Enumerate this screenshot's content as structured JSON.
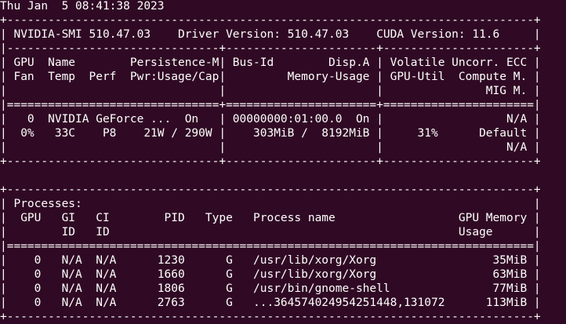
{
  "terminal": {
    "background_color": "#300a24",
    "text_color": "#ffffff",
    "lines": [
      "Thu Jan  5 08:41:38 2023",
      "+-----------------------------------------------------------------------------+",
      "| NVIDIA-SMI 510.47.03    Driver Version: 510.47.03    CUDA Version: 11.6     |",
      "|-------------------------------+----------------------+----------------------+",
      "| GPU  Name        Persistence-M| Bus-Id        Disp.A | Volatile Uncorr. ECC |",
      "| Fan  Temp  Perf  Pwr:Usage/Cap|         Memory-Usage | GPU-Util  Compute M. |",
      "|                               |                      |               MIG M. |",
      "|===============================+======================+======================|",
      "|   0  NVIDIA GeForce ...  On   | 00000000:01:00.0  On |                  N/A |",
      "|  0%   33C    P8    21W / 290W |    303MiB /  8192MiB |     31%      Default |",
      "|                               |                      |                  N/A |",
      "+-------------------------------+----------------------+----------------------+",
      "",
      "+-----------------------------------------------------------------------------+",
      "| Processes:                                                                  |",
      "|  GPU   GI   CI        PID   Type   Process name                  GPU Memory |",
      "|        ID   ID                                                   Usage      |",
      "|=============================================================================|",
      "|    0   N/A  N/A      1230      G   /usr/lib/xorg/Xorg                 35MiB |",
      "|    0   N/A  N/A      1660      G   /usr/lib/xorg/Xorg                 63MiB |",
      "|    0   N/A  N/A      1806      G   /usr/bin/gnome-shell               77MiB |",
      "|    0   N/A  N/A      2763      G   ...364574024954251448,131072      113MiB |",
      "+-----------------------------------------------------------------------------+"
    ]
  }
}
